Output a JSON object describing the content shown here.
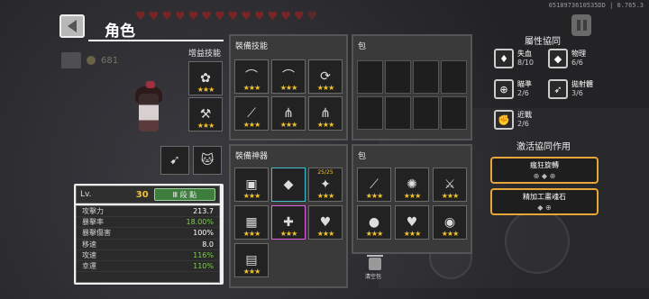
{
  "version": "0518973610535DD | 0.765.3",
  "header": {
    "title": "角色",
    "coins": "681"
  },
  "hearts": {
    "filled": 13,
    "total": 14
  },
  "buffs": {
    "label": "增益技能"
  },
  "stats": {
    "level_label": "Lv.",
    "level": "30",
    "level_button": "Ⅲ 段 點",
    "rows": [
      {
        "label": "攻擊力",
        "value": "213.7",
        "highlight": false
      },
      {
        "label": "暴擊率",
        "value": "18.00%",
        "highlight": true
      },
      {
        "label": "暴擊傷害",
        "value": "100%",
        "highlight": false
      },
      {
        "label": "移速",
        "value": "8.0",
        "highlight": false
      },
      {
        "label": "攻速",
        "value": "116%",
        "highlight": true
      },
      {
        "label": "幸運",
        "value": "110%",
        "highlight": true
      }
    ]
  },
  "panels": {
    "equip_skills": "裝備技能",
    "bag_top": "包",
    "equip_artifacts": "裝備神器",
    "bag_bottom": "包",
    "artifact_counter": "25/25",
    "clear_bag": "清空包"
  },
  "synergy": {
    "title": "屬性協同",
    "items": [
      {
        "name": "失血",
        "count": "8/10",
        "icon": "blood-drop-icon",
        "glyph": "♦"
      },
      {
        "name": "物理",
        "count": "6/6",
        "icon": "gem-icon",
        "glyph": "◆"
      },
      {
        "name": "瞄準",
        "count": "2/6",
        "icon": "crosshair-icon",
        "glyph": "⊕"
      },
      {
        "name": "拋射體",
        "count": "3/6",
        "icon": "projectile-icon",
        "glyph": "➶"
      },
      {
        "name": "近戰",
        "count": "2/6",
        "icon": "fist-icon",
        "glyph": "✊"
      }
    ],
    "active_title": "激活協同作用",
    "active": [
      {
        "name": "瘋狂旋轉",
        "icons": "⊕ ◆ ⊕"
      },
      {
        "name": "精加工畫魂石",
        "icons": "◆ ⊕"
      }
    ]
  },
  "colors": {
    "star": "#f2c230",
    "accent_border": "#e6a63a",
    "green": "#7bd04a"
  }
}
